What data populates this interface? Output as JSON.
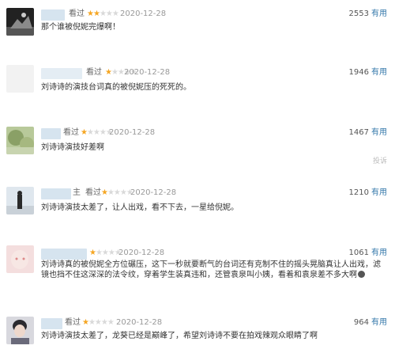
{
  "watched_label": "看过",
  "useful_label": "有用",
  "report_label": "投诉",
  "reviews": [
    {
      "date": "2020-12-28",
      "stars": 2,
      "votes": "2553",
      "content": "那个谁被倪妮完爆啊！"
    },
    {
      "date": "2020-12-28",
      "stars": 1,
      "votes": "1946",
      "content": "刘诗诗的演技台词真的被倪妮压的死死的。"
    },
    {
      "date": "2020-12-28",
      "stars": 1,
      "votes": "1467",
      "content": "刘诗诗演技好差啊"
    },
    {
      "date": "2020-12-28",
      "stars": 1,
      "votes": "1210",
      "name_suffix": "主",
      "content": "刘诗诗演技太差了，让人出戏，看不下去，一星给倪妮。"
    },
    {
      "date": "2020-12-28",
      "stars": 1,
      "votes": "1061",
      "content": "刘诗诗真的被倪妮全方位碾压，这下一秒就要断气的台词还有克制不住的摇头晃脑真让人出戏，滤镜也挡不住这深深的法令纹，穿着学生装真违和，还管袁泉叫小姨，看着和袁泉差不多大啊"
    },
    {
      "date": "2020-12-28",
      "stars": 1,
      "votes": "964",
      "content": "刘诗诗演技太差了，龙葵已经是巅峰了，希望刘诗诗不要在拍戏辣观众眼睛了啊"
    }
  ]
}
